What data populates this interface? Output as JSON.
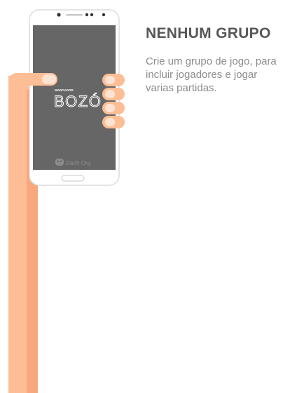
{
  "phone_screen": {
    "logo_small": "MARCADOR",
    "logo_big": "BOZÓ",
    "footer_brand": "Darth Org"
  },
  "empty_state": {
    "title": "NENHUM GRUPO",
    "message": "Crie um grupo de jogo, para incluir jogadores e jogar varias partidas."
  },
  "colors": {
    "skin": "#FDBE96",
    "skin_shadow": "#F9A77C",
    "nail": "#FFE3D2",
    "phone_body": "#FFFFFF",
    "phone_outline": "#DCDCDC",
    "screen": "#666666"
  }
}
